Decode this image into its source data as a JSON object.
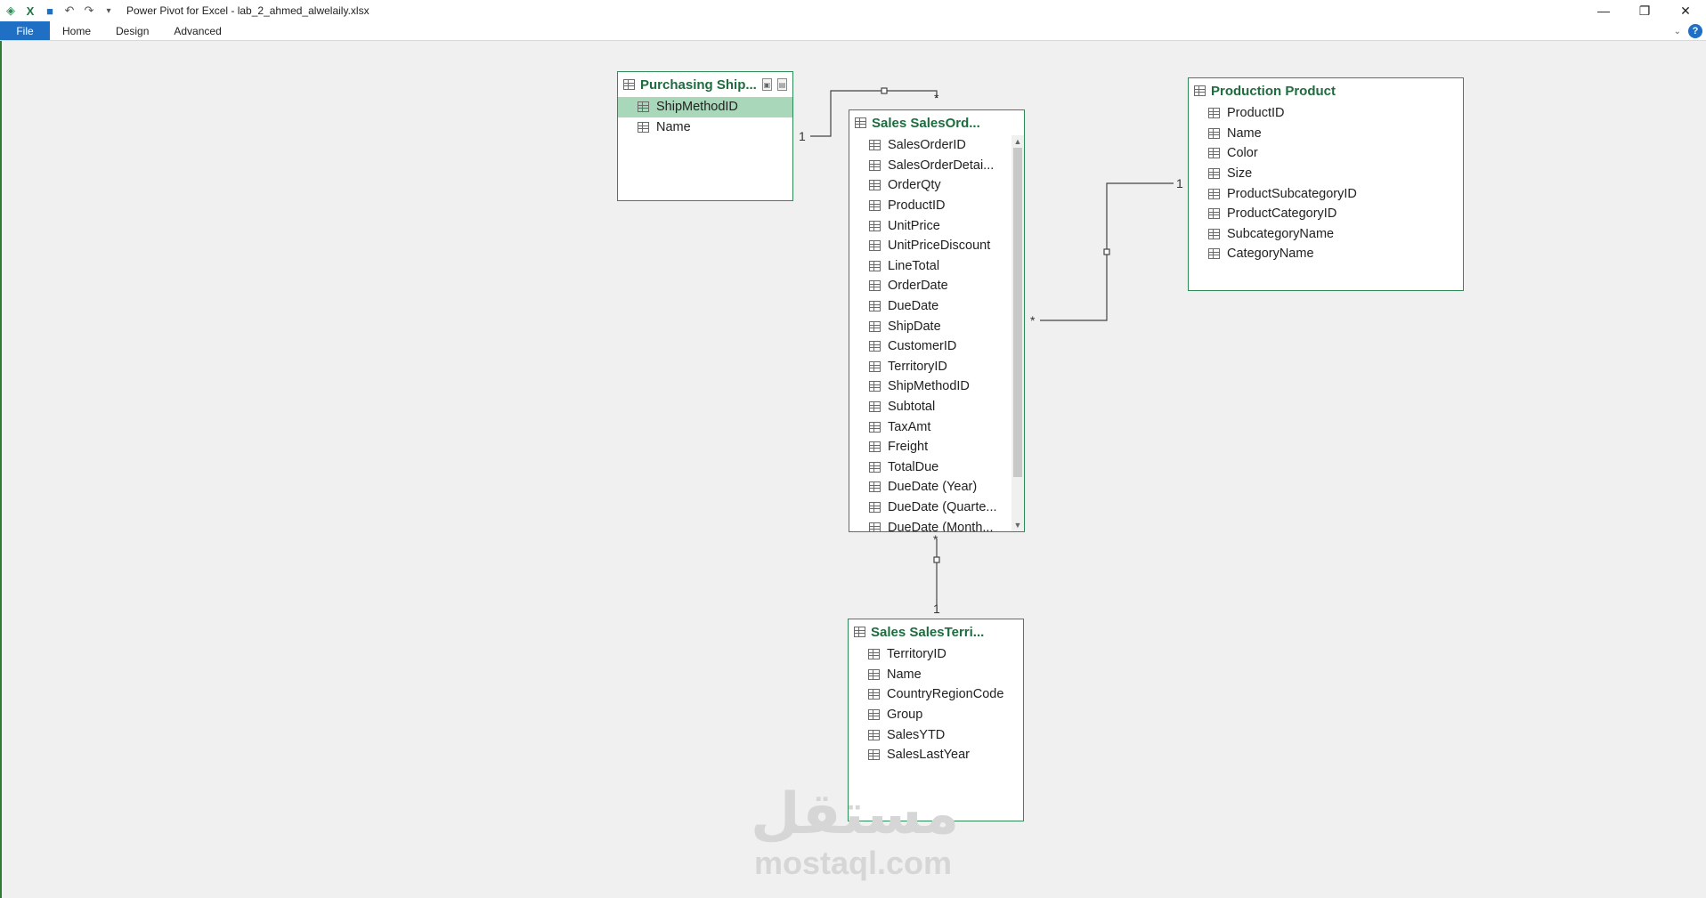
{
  "window": {
    "title": "Power Pivot for Excel - lab_2_ahmed_alwelaily.xlsx",
    "controls": {
      "minimize": "—",
      "restore": "❐",
      "close": "✕"
    }
  },
  "qat": {
    "save_icon": "💾",
    "undo_icon": "↶",
    "redo_icon": "↷",
    "customize_icon": "▾"
  },
  "ribbon": {
    "tabs": [
      {
        "label": "File"
      },
      {
        "label": "Home"
      },
      {
        "label": "Design"
      },
      {
        "label": "Advanced"
      }
    ],
    "help": "?",
    "collapse": "⌄"
  },
  "tables": {
    "purchasing": {
      "title": "Purchasing Ship...",
      "columns": [
        "ShipMethodID",
        "Name"
      ],
      "selected": "ShipMethodID"
    },
    "salesorder": {
      "title": "Sales SalesOrd...",
      "columns": [
        "SalesOrderID",
        "SalesOrderDetai...",
        "OrderQty",
        "ProductID",
        "UnitPrice",
        "UnitPriceDiscount",
        "LineTotal",
        "OrderDate",
        "DueDate",
        "ShipDate",
        "CustomerID",
        "TerritoryID",
        "ShipMethodID",
        "Subtotal",
        "TaxAmt",
        "Freight",
        "TotalDue",
        "DueDate (Year)",
        "DueDate (Quarte...",
        "DueDate (Month..."
      ]
    },
    "product": {
      "title": "Production Product",
      "columns": [
        "ProductID",
        "Name",
        "Color",
        "Size",
        "ProductSubcategoryID",
        "ProductCategoryID",
        "SubcategoryName",
        "CategoryName"
      ]
    },
    "territory": {
      "title": "Sales SalesTerri...",
      "columns": [
        "TerritoryID",
        "Name",
        "CountryRegionCode",
        "Group",
        "SalesYTD",
        "SalesLastYear"
      ]
    }
  },
  "relationships": {
    "ship_one": "1",
    "ship_many": "*",
    "product_one": "1",
    "product_many": "*",
    "territory_many": "*",
    "territory_one": "1"
  },
  "watermark": {
    "arabic": "مستقل",
    "latin": "mostaql.com"
  }
}
